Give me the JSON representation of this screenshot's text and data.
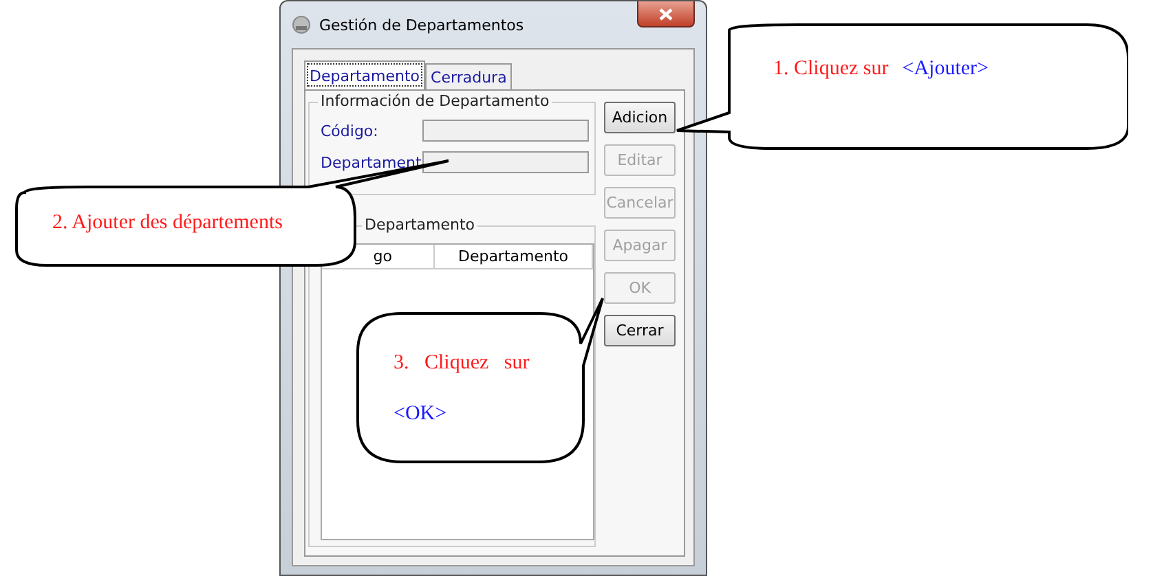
{
  "window": {
    "title": "Gestión de Departamentos"
  },
  "tabs": [
    {
      "label": "Departamento",
      "selected": true
    },
    {
      "label": "Cerradura",
      "selected": false
    }
  ],
  "info_group": {
    "title": "Información de Departamento",
    "fields": [
      {
        "label": "Código:"
      },
      {
        "label": "Departament"
      }
    ]
  },
  "list_group": {
    "title": "Departamento",
    "columns": [
      "go",
      "Departamento"
    ]
  },
  "buttons": [
    {
      "label": "Adicion",
      "disabled": false
    },
    {
      "label": "Editar",
      "disabled": true
    },
    {
      "label": "Cancelar",
      "disabled": true
    },
    {
      "label": "Apagar",
      "disabled": true
    },
    {
      "label": "OK",
      "disabled": true
    },
    {
      "label": "Cerrar",
      "disabled": false
    }
  ],
  "callouts": [
    {
      "kind": "right",
      "text": "1. Cliquez sur",
      "target": "<Ajouter>"
    },
    {
      "kind": "left",
      "text": "2. Ajouter des départements"
    },
    {
      "kind": "middle",
      "text": "3.   Cliquez   sur",
      "target": "<OK>"
    }
  ]
}
